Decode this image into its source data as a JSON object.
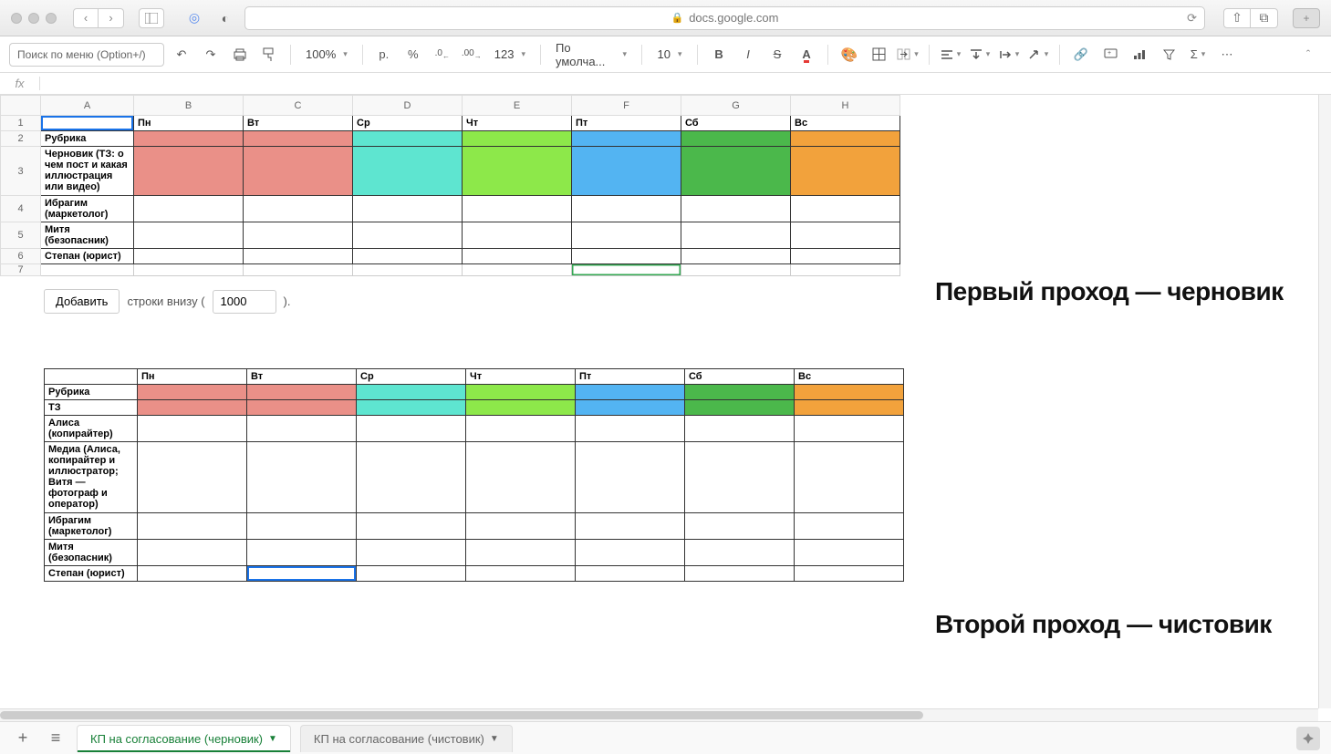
{
  "browser": {
    "url": "docs.google.com"
  },
  "toolbar": {
    "menu_search_placeholder": "Поиск по меню (Option+/)",
    "zoom": "100%",
    "currency": "р.",
    "percent": "%",
    "dec_dec": ".0",
    "dec_inc": ".00",
    "num_format": "123",
    "font": "По умолча...",
    "font_size": "10"
  },
  "colors": {
    "red": "#ea9999",
    "red2": "#ea9088",
    "teal": "#5ee5d0",
    "lime": "#8de84a",
    "blue": "#53b4f2",
    "green": "#4bb84b",
    "orange": "#f2a23c"
  },
  "columns": [
    "A",
    "B",
    "C",
    "D",
    "E",
    "F",
    "G",
    "H"
  ],
  "days": [
    "Пн",
    "Вт",
    "Ср",
    "Чт",
    "Пт",
    "Сб",
    "Вс"
  ],
  "table1": {
    "rows": [
      "",
      "Рубрика",
      "Черновик (ТЗ: о чем пост и какая иллюстрация или видео)",
      "Ибрагим (маркетолог)",
      "Митя (безопасник)",
      "Степан (юрист)",
      ""
    ],
    "row_numbers": [
      "1",
      "2",
      "3",
      "4",
      "5",
      "6",
      "7"
    ]
  },
  "add_rows": {
    "button": "Добавить",
    "label_before": "строки внизу (",
    "value": "1000",
    "label_after": ")."
  },
  "table2": {
    "rows": [
      "",
      "Рубрика",
      "ТЗ",
      "Алиса (копирайтер)",
      "Медиа (Алиса, копирайтер и иллюстратор; Витя — фотограф и оператор)",
      "Ибрагим (маркетолог)",
      "Митя (безопасник)",
      "Степан (юрист)"
    ]
  },
  "annotations": {
    "first": "Первый проход — черновик",
    "second": "Второй проход — чистовик"
  },
  "tabs": {
    "active": "КП на согласование (черновик)",
    "inactive": "КП на согласование (чистовик)"
  }
}
